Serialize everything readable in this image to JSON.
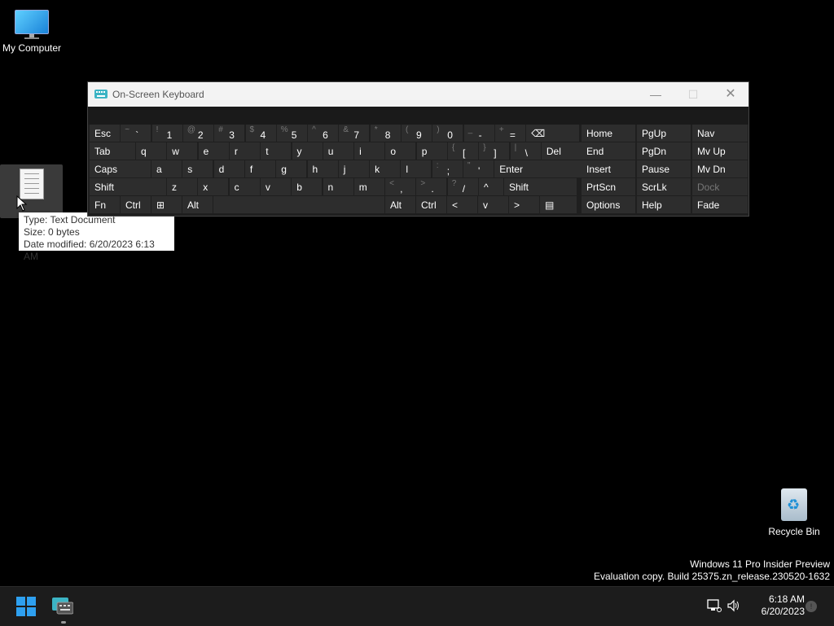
{
  "desktop": {
    "my_computer_label": "My Computer",
    "recycle_bin_label": "Recycle Bin"
  },
  "tooltip": {
    "type": "Type: Text Document",
    "size": "Size: 0 bytes",
    "date": "Date modified: 6/20/2023 6:13 AM"
  },
  "osk": {
    "title": "On-Screen Keyboard",
    "minimize": "—",
    "maximize": "☐",
    "close": "✕",
    "row1": [
      {
        "label": "Esc"
      },
      {
        "shift": "~",
        "main": "`"
      },
      {
        "shift": "!",
        "main": "1"
      },
      {
        "shift": "@",
        "main": "2"
      },
      {
        "shift": "#",
        "main": "3"
      },
      {
        "shift": "$",
        "main": "4"
      },
      {
        "shift": "%",
        "main": "5"
      },
      {
        "shift": "^",
        "main": "6"
      },
      {
        "shift": "&",
        "main": "7"
      },
      {
        "shift": "*",
        "main": "8"
      },
      {
        "shift": "(",
        "main": "9"
      },
      {
        "shift": ")",
        "main": "0"
      },
      {
        "shift": "_",
        "main": "-"
      },
      {
        "shift": "+",
        "main": "="
      },
      {
        "label": "⌫"
      }
    ],
    "row2": [
      "Tab",
      "q",
      "w",
      "e",
      "r",
      "t",
      "y",
      "u",
      "i",
      "o",
      "p"
    ],
    "row2_brackets": [
      {
        "shift": "{",
        "main": "["
      },
      {
        "shift": "}",
        "main": "]"
      },
      {
        "shift": "|",
        "main": "\\"
      }
    ],
    "row2_del": "Del",
    "row3": [
      "Caps",
      "a",
      "s",
      "d",
      "f",
      "g",
      "h",
      "j",
      "k",
      "l"
    ],
    "row3_punct": [
      {
        "shift": ":",
        "main": ";"
      },
      {
        "shift": "\"",
        "main": "'"
      }
    ],
    "row3_enter": "Enter",
    "row4": [
      "Shift",
      "z",
      "x",
      "c",
      "v",
      "b",
      "n",
      "m"
    ],
    "row4_punct": [
      {
        "shift": "<",
        "main": ","
      },
      {
        "shift": ">",
        "main": "."
      },
      {
        "shift": "?",
        "main": "/"
      }
    ],
    "row4_up": "^",
    "row4_shift": "Shift",
    "row5": {
      "fn": "Fn",
      "ctrl": "Ctrl",
      "win": "⊞",
      "alt": "Alt",
      "alt_r": "Alt",
      "ctrl_r": "Ctrl",
      "left": "<",
      "down": "v",
      "right": ">",
      "menu": "▤"
    },
    "nav": [
      [
        "Home",
        "PgUp",
        "Nav"
      ],
      [
        "End",
        "PgDn",
        "Mv Up"
      ],
      [
        "Insert",
        "Pause",
        "Mv Dn"
      ],
      [
        "PrtScn",
        "ScrLk",
        "Dock"
      ],
      [
        "Options",
        "Help",
        "Fade"
      ]
    ]
  },
  "watermark": {
    "line1": "Windows 11 Pro Insider Preview",
    "line2": "Evaluation copy. Build 25375.zn_release.230520-1632"
  },
  "taskbar": {
    "time": "6:18 AM",
    "date": "6/20/2023"
  }
}
